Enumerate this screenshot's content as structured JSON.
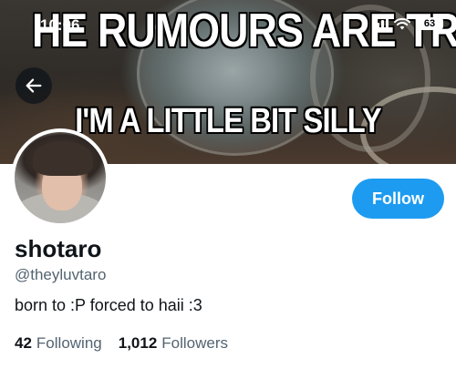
{
  "banner": {
    "top_text": "HE RUMOURS ARE TRU",
    "bottom_text": "I'M A LITTLE BIT SILLY"
  },
  "status_bar": {
    "time": "10:06",
    "battery": "63",
    "icons": [
      "signal-icon",
      "wifi-icon",
      "battery-icon"
    ]
  },
  "nav": {
    "back_icon": "arrow-left-icon"
  },
  "profile": {
    "name": "shotaro",
    "handle": "@theyluvtaro",
    "bio": "born to :P forced to haii :3",
    "following_count": "42",
    "following_label": "Following",
    "followers_count": "1,012",
    "followers_label": "Followers"
  },
  "actions": {
    "follow_label": "Follow"
  },
  "colors": {
    "accent": "#1d9bf0",
    "text_primary": "#0f1419",
    "text_secondary": "#536471"
  }
}
